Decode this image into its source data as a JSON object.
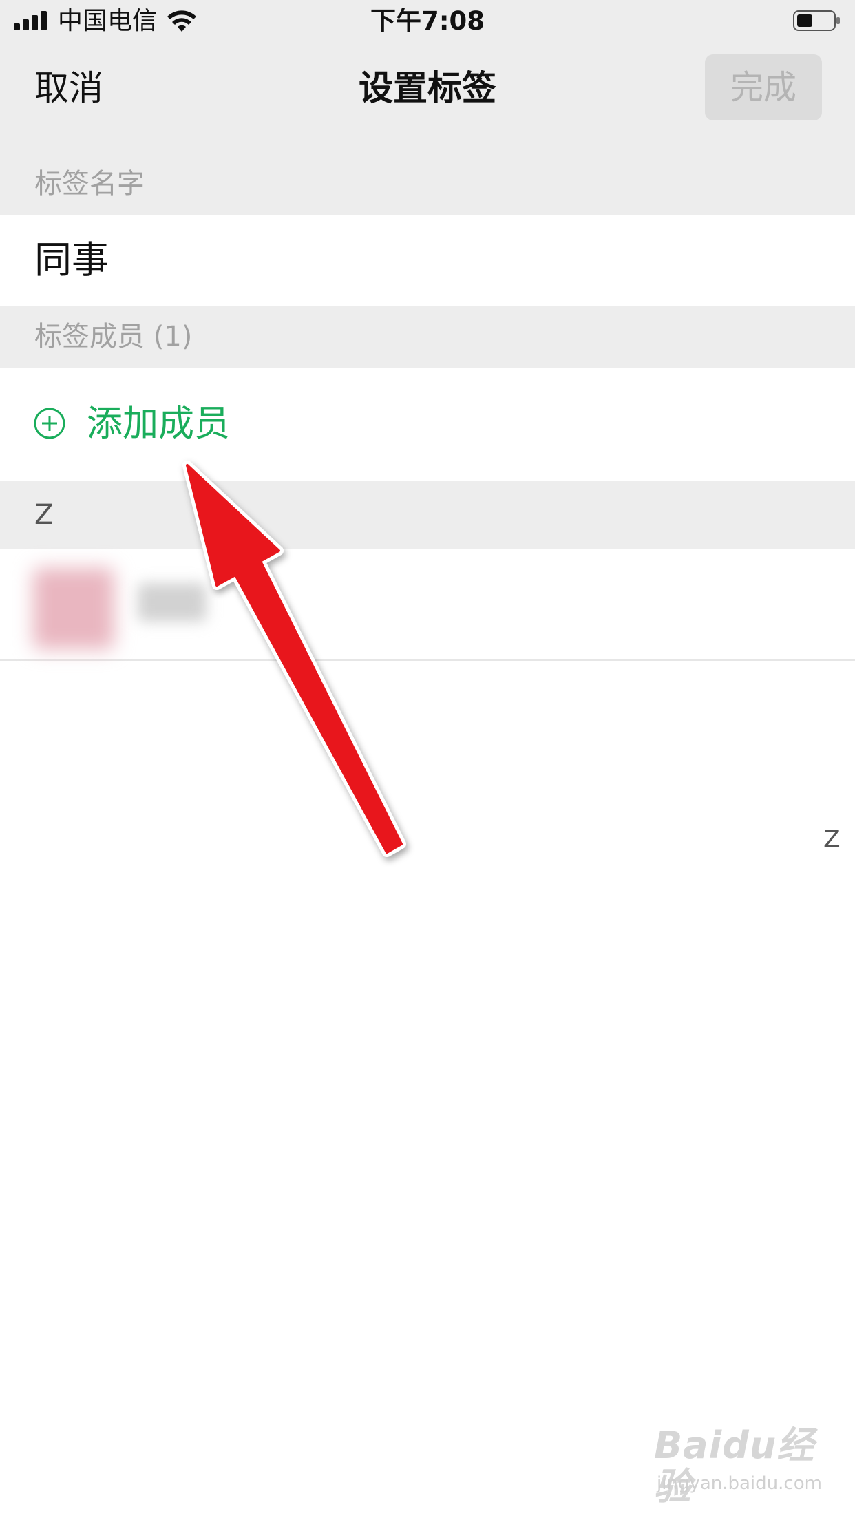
{
  "status_bar": {
    "carrier": "中国电信",
    "time": "下午7:08",
    "icons": [
      "signal-icon",
      "wifi-icon",
      "battery-icon"
    ]
  },
  "nav": {
    "cancel_label": "取消",
    "title": "设置标签",
    "done_label": "完成"
  },
  "label_name_section": {
    "header": "标签名字",
    "value": "同事"
  },
  "members_section": {
    "header": "标签成员 (1)",
    "add_member_label": "添加成员",
    "add_icon": "plus-circle-icon",
    "index_letter": "Z",
    "members": [
      {
        "name": "",
        "avatar": "blurred-avatar"
      }
    ]
  },
  "side_index": [
    "Z"
  ],
  "annotation": {
    "icon": "red-arrow-icon",
    "color": "#e8131b"
  },
  "watermark": {
    "logo": "Baidu经验",
    "url": "jingyan.baidu.com"
  },
  "colors": {
    "accent_green": "#1aad5b",
    "header_gray": "#ededed",
    "disabled_button": "#dcdcdc"
  }
}
